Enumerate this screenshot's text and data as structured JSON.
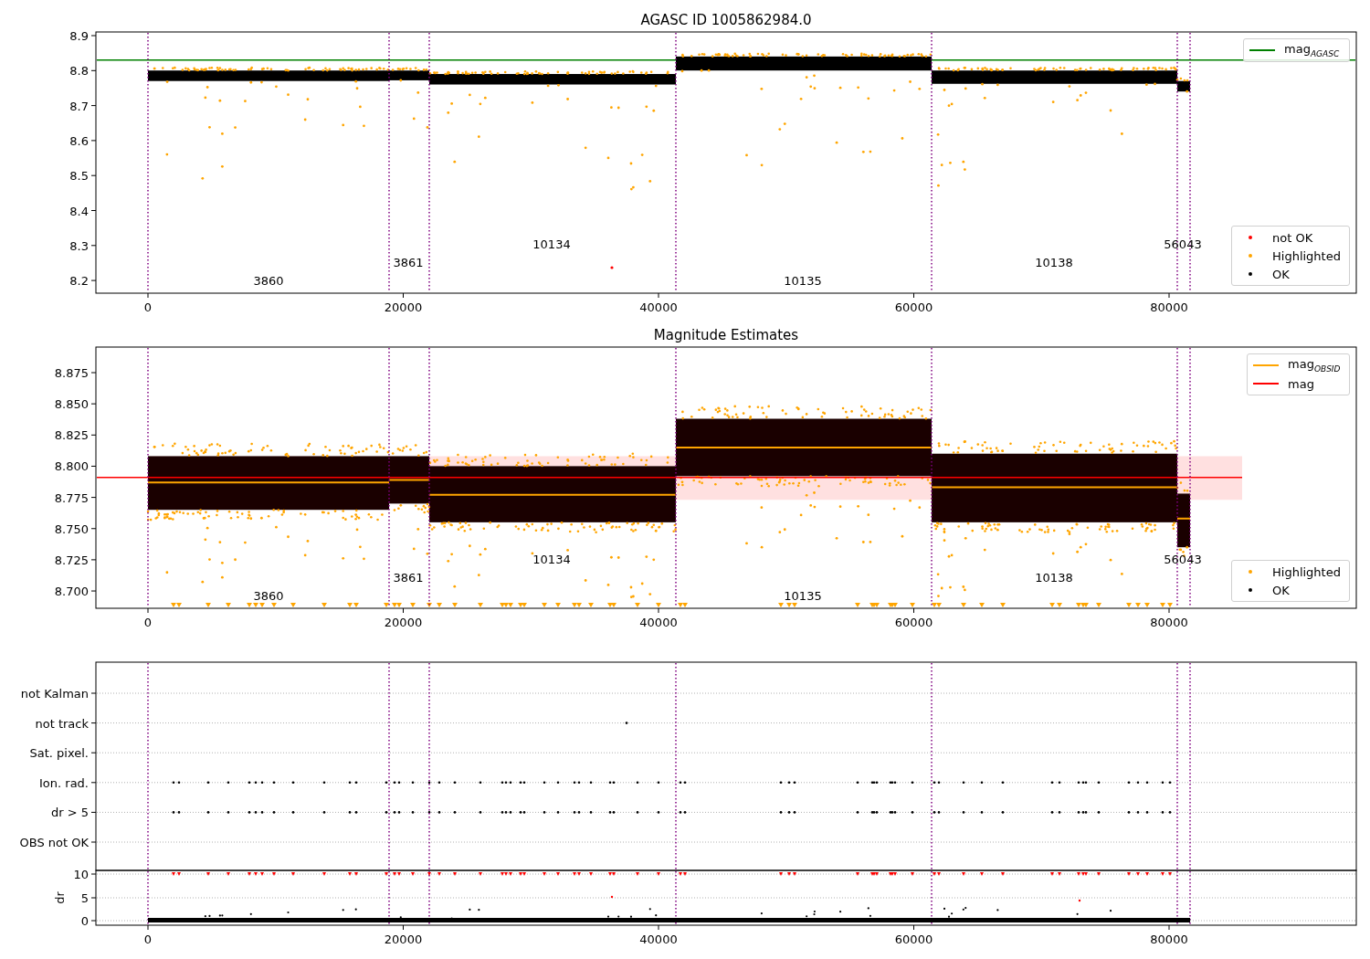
{
  "top_panel": {
    "title": "AGASC ID 1005862984.0",
    "yticks": [
      "8.9",
      "8.8",
      "8.7",
      "8.6",
      "8.5",
      "8.4",
      "8.3",
      "8.2"
    ],
    "xticks": [
      "0",
      "20000",
      "40000",
      "60000",
      "80000"
    ],
    "obsid_labels": [
      "3860",
      "3861",
      "10134",
      "10135",
      "10138",
      "56043"
    ],
    "line_legend": [
      {
        "label": "mag$_{AGASC}$",
        "color": "#008000"
      }
    ],
    "point_legend": [
      {
        "label": "not OK",
        "color": "#ff0000"
      },
      {
        "label": "Highlighted",
        "color": "#ffa500"
      },
      {
        "label": "OK",
        "color": "#000000"
      }
    ]
  },
  "middle_panel": {
    "title": "Magnitude Estimates",
    "yticks": [
      "8.875",
      "8.850",
      "8.825",
      "8.800",
      "8.775",
      "8.750",
      "8.725",
      "8.700"
    ],
    "xticks": [
      "0",
      "20000",
      "40000",
      "60000",
      "80000"
    ],
    "obsid_labels": [
      "3860",
      "3861",
      "10134",
      "10135",
      "10138",
      "56043"
    ],
    "line_legend": [
      {
        "label": "mag$_{OBSID}$",
        "color": "#ffa500"
      },
      {
        "label": "mag",
        "color": "#ff0000"
      }
    ],
    "point_legend": [
      {
        "label": "Highlighted",
        "color": "#ffa500"
      },
      {
        "label": "OK",
        "color": "#000000"
      }
    ]
  },
  "flags_panel": {
    "categories": [
      "not Kalman",
      "not track",
      "Sat. pixel.",
      "Ion. rad.",
      "dr > 5",
      "OBS not OK"
    ]
  },
  "dr_panel": {
    "ylabel": "dr",
    "yticks": [
      "10",
      "5",
      "0"
    ],
    "xticks": [
      "0",
      "20000",
      "40000",
      "60000",
      "80000"
    ]
  }
}
